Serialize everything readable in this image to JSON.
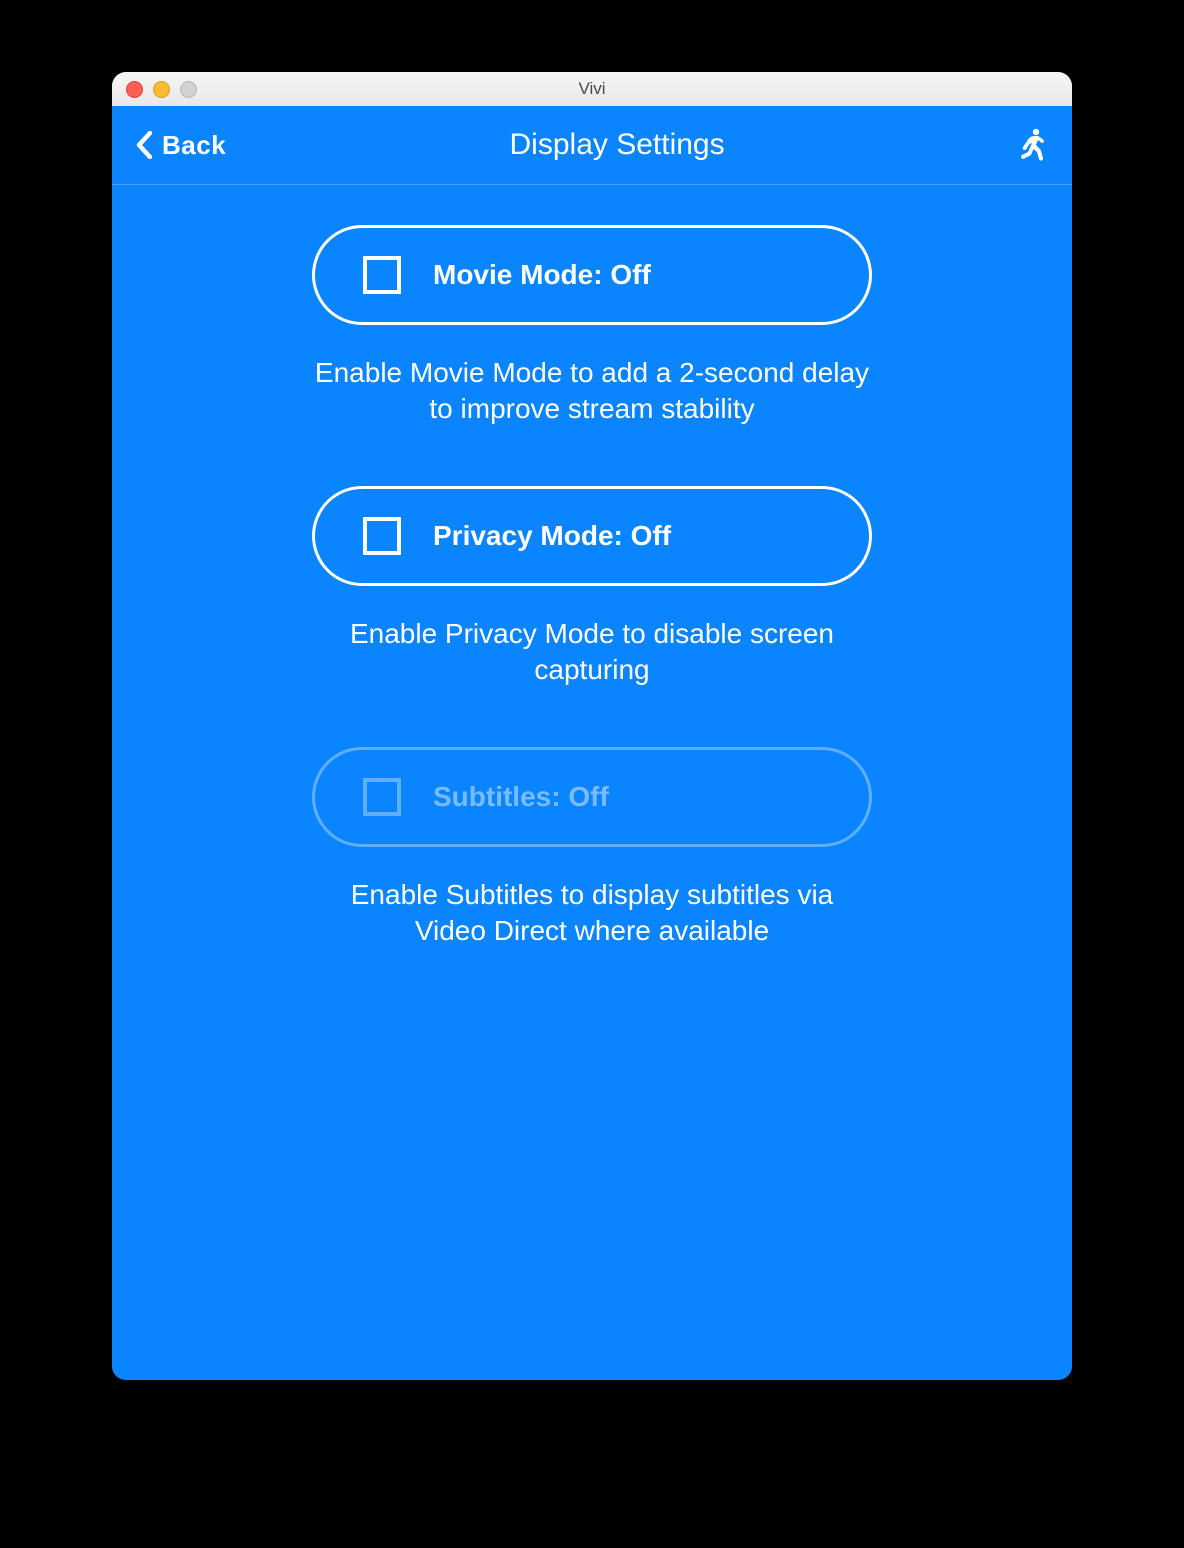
{
  "window": {
    "title": "Vivi"
  },
  "nav": {
    "back_label": "Back",
    "title": "Display Settings"
  },
  "settings": {
    "movie": {
      "label": "Movie Mode: Off",
      "description": "Enable Movie Mode to add a 2-second delay to improve stream stability",
      "enabled": true
    },
    "privacy": {
      "label": "Privacy Mode: Off",
      "description": "Enable Privacy Mode to disable screen capturing",
      "enabled": true
    },
    "subtitles": {
      "label": "Subtitles: Off",
      "description": "Enable Subtitles to display subtitles via Video Direct where available",
      "enabled": false
    }
  }
}
